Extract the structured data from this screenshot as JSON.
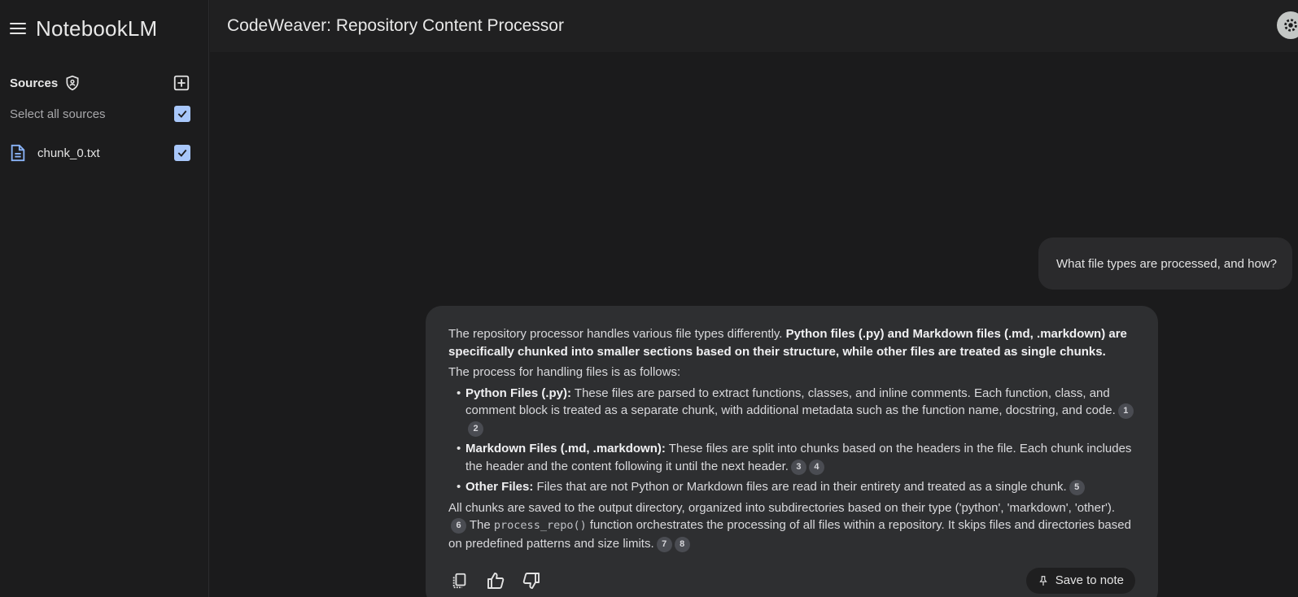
{
  "app": {
    "brand": "NotebookLM"
  },
  "header": {
    "notebook_title": "CodeWeaver: Repository Content Processor"
  },
  "sidebar": {
    "sources_title": "Sources",
    "select_all_label": "Select all sources",
    "sources": [
      {
        "name": "chunk_0.txt",
        "checked": true
      }
    ]
  },
  "chat": {
    "user_message": "What file types are processed, and how?",
    "answer": {
      "intro_plain": "The repository processor handles various file types differently. ",
      "intro_bold": "Python files (.py) and Markdown files (.md, .markdown) are specifically chunked into smaller sections based on their structure, while other files are treated as single chunks.",
      "process_line": "The process for handling files is as follows:",
      "bullets": [
        {
          "title": "Python Files (.py):",
          "text": " These files are parsed to extract functions, classes, and inline comments. Each function, class, and comment block is treated as a separate chunk, with additional metadata such as the function name, docstring, and code.",
          "cites": [
            "1",
            "2"
          ]
        },
        {
          "title": "Markdown Files (.md, .markdown):",
          "text": " These files are split into chunks based on the headers in the file. Each chunk includes the header and the content following it until the next header.",
          "cites": [
            "3",
            "4"
          ]
        },
        {
          "title": "Other Files:",
          "text": " Files that are not Python or Markdown files are read in their entirety and treated as a single chunk.",
          "cites": [
            "5"
          ]
        }
      ],
      "closing_1": "All chunks are saved to the output directory, organized into subdirectories based on their type ('python', 'markdown', 'other').",
      "closing_cite_1": "6",
      "closing_2_pre": " The ",
      "closing_code": "process_repo()",
      "closing_2_post": " function orchestrates the processing of all files within a repository. It skips files and directories based on predefined patterns and size limits.",
      "closing_cites": [
        "7",
        "8"
      ]
    },
    "save_to_note_label": "Save to note"
  },
  "colors": {
    "accent": "#a8c7fa",
    "background": "#1b1b1c",
    "card": "#2e2f31"
  }
}
